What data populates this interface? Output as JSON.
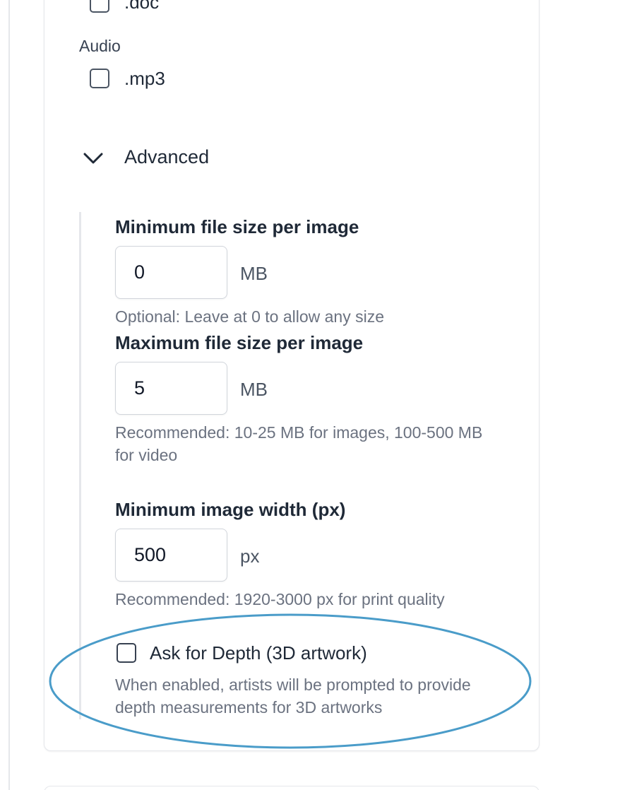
{
  "file_types": {
    "doc_option": ".doc",
    "audio_group_label": "Audio",
    "mp3_option": ".mp3"
  },
  "advanced": {
    "title": "Advanced",
    "min_file_size": {
      "label": "Minimum file size per image",
      "value": "0",
      "unit": "MB",
      "help": "Optional: Leave at 0 to allow any size"
    },
    "max_file_size": {
      "label": "Maximum file size per image",
      "value": "5",
      "unit": "MB",
      "help": "Recommended: 10-25 MB for images, 100-500 MB for video"
    },
    "min_width": {
      "label": "Minimum image width (px)",
      "value": "500",
      "unit": "px",
      "help": "Recommended: 1920-3000 px for print quality"
    },
    "depth": {
      "label": "Ask for Depth (3D artwork)",
      "checked": false,
      "help": "When enabled, artists will be prompted to provide depth measurements for 3D artworks"
    }
  },
  "colors": {
    "highlight_ellipse": "#4a9cc9",
    "text": "#1f2937",
    "muted": "#6b7280",
    "border": "#e5e7eb"
  },
  "icons": {
    "collapse": "chevron-down-icon"
  }
}
